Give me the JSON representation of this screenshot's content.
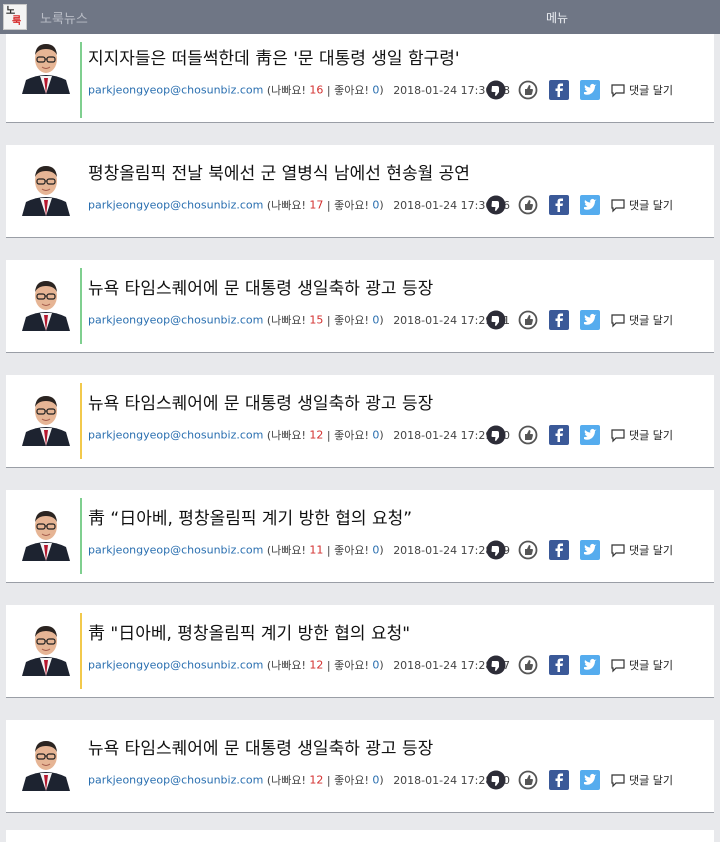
{
  "header": {
    "logo_top": "노",
    "logo_bottom": "룩",
    "site_title": "노룩뉴스",
    "menu_label": "메뉴"
  },
  "labels": {
    "bad_prefix": "(나빠요!",
    "good_prefix": "| 좋아요!",
    "suffix": ")",
    "comment": "댓글 달기"
  },
  "articles": [
    {
      "title": "지지자들은 떠들썩한데 靑은 '문 대통령 생일 함구령'",
      "email": "parkjeongyeop@chosunbiz.com",
      "bad": "16",
      "good": "0",
      "time": "2018-01-24 17:30:08",
      "accent": "green"
    },
    {
      "title": "평창올림픽 전날 북에선 군 열병식 남에선 현송월 공연",
      "email": "parkjeongyeop@chosunbiz.com",
      "bad": "17",
      "good": "0",
      "time": "2018-01-24 17:30:06",
      "accent": "none"
    },
    {
      "title": "뉴욕 타임스퀘어에 문 대통령 생일축하 광고 등장",
      "email": "parkjeongyeop@chosunbiz.com",
      "bad": "15",
      "good": "0",
      "time": "2018-01-24 17:29:41",
      "accent": "green"
    },
    {
      "title": "뉴욕 타임스퀘어에 문 대통령 생일축하 광고 등장",
      "email": "parkjeongyeop@chosunbiz.com",
      "bad": "12",
      "good": "0",
      "time": "2018-01-24 17:29:30",
      "accent": "yellow"
    },
    {
      "title": "靑 “日아베, 평창올림픽 계기 방한 협의 요청”",
      "email": "parkjeongyeop@chosunbiz.com",
      "bad": "11",
      "good": "0",
      "time": "2018-01-24 17:28:59",
      "accent": "green"
    },
    {
      "title": "靑 \"日아베, 평창올림픽 계기 방한 협의 요청\"",
      "email": "parkjeongyeop@chosunbiz.com",
      "bad": "12",
      "good": "0",
      "time": "2018-01-24 17:28:27",
      "accent": "yellow"
    },
    {
      "title": "뉴욕 타임스퀘어에 문 대통령 생일축하 광고 등장",
      "email": "parkjeongyeop@chosunbiz.com",
      "bad": "12",
      "good": "0",
      "time": "2018-01-24 17:28:10",
      "accent": "none"
    }
  ],
  "icons": [
    "thumbs-down-icon",
    "thumbs-up-icon",
    "facebook-icon",
    "twitter-icon",
    "comment-icon",
    "avatar"
  ],
  "colors": {
    "header_bg": "#6f7685",
    "link_blue": "#2a6fb0",
    "bad_red": "#d3302f",
    "accent_green": "#7fcf8f",
    "accent_yellow": "#f2c94c",
    "facebook": "#3b5998",
    "twitter": "#55acee"
  }
}
